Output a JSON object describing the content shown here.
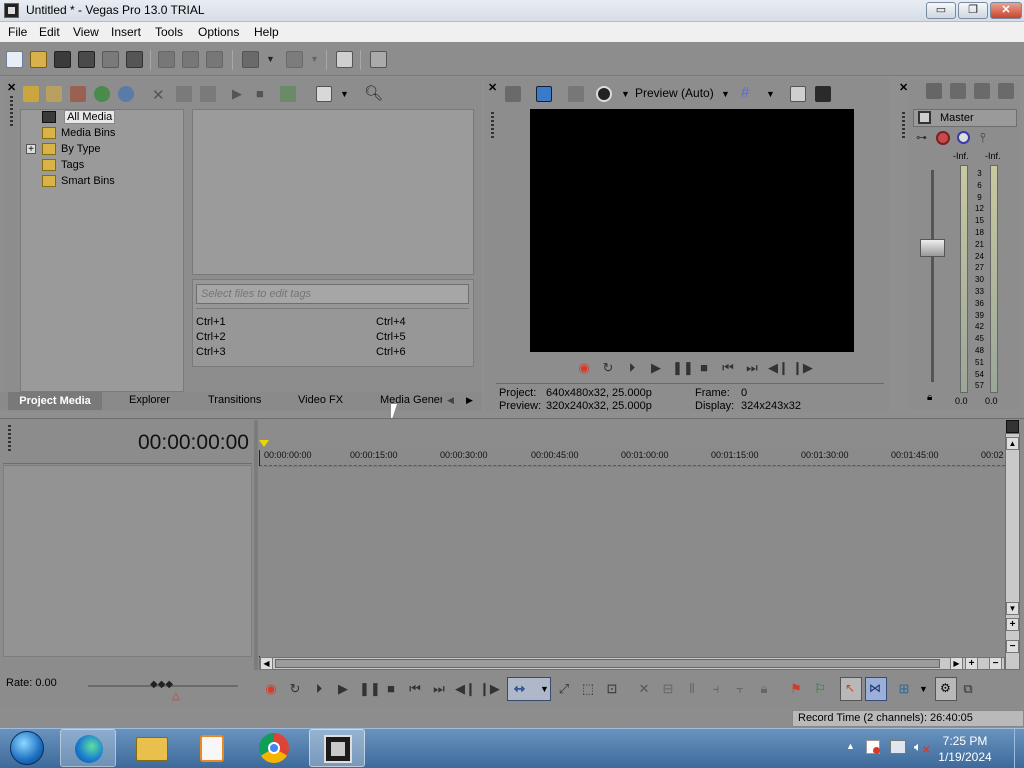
{
  "window": {
    "title": "Untitled * - Vegas Pro 13.0 TRIAL",
    "min": "▭",
    "max": "❐",
    "close": "✕"
  },
  "menu": [
    "File",
    "Edit",
    "View",
    "Insert",
    "Tools",
    "Options",
    "Help"
  ],
  "explorer": {
    "tree": [
      "All Media",
      "Media Bins",
      "By Type",
      "Tags",
      "Smart Bins"
    ],
    "expander": "+",
    "tag_placeholder": "Select files to edit tags",
    "shortcuts": [
      "Ctrl+1",
      "Ctrl+2",
      "Ctrl+3",
      "Ctrl+4",
      "Ctrl+5",
      "Ctrl+6"
    ],
    "tabs": [
      "Project Media",
      "Explorer",
      "Transitions",
      "Video FX",
      "Media Genera"
    ]
  },
  "preview": {
    "mode": "Preview (Auto)",
    "project_label": "Project:",
    "project_value": "640x480x32, 25.000p",
    "preview_label": "Preview:",
    "preview_value": "320x240x32, 25.000p",
    "frame_label": "Frame:",
    "frame_value": "0",
    "display_label": "Display:",
    "display_value": "324x243x32"
  },
  "master": {
    "title": "Master",
    "peak_left": "-Inf.",
    "peak_right": "-Inf.",
    "scale": [
      "3",
      "6",
      "9",
      "12",
      "15",
      "18",
      "21",
      "24",
      "27",
      "30",
      "33",
      "36",
      "39",
      "42",
      "45",
      "48",
      "51",
      "54",
      "57"
    ],
    "level_left": "0.0",
    "level_right": "0.0"
  },
  "timeline": {
    "timecode": "00:00:00:00",
    "ruler": [
      "00:00:00:00",
      "00:00:15:00",
      "00:00:30:00",
      "00:00:45:00",
      "00:01:00:00",
      "00:01:15:00",
      "00:01:30:00",
      "00:01:45:00",
      "00:02"
    ],
    "rate": "Rate: 0.00"
  },
  "status": {
    "record_time": "Record Time (2 channels): 26:40:05"
  },
  "taskbar": {
    "time": "7:25 PM",
    "date": "1/19/2024"
  },
  "colors": {
    "accent_red": "#d83a2a",
    "preview_bg": "#000000",
    "panel_bg": "#8d8d8d",
    "taskbar": "#3d6a9b"
  }
}
